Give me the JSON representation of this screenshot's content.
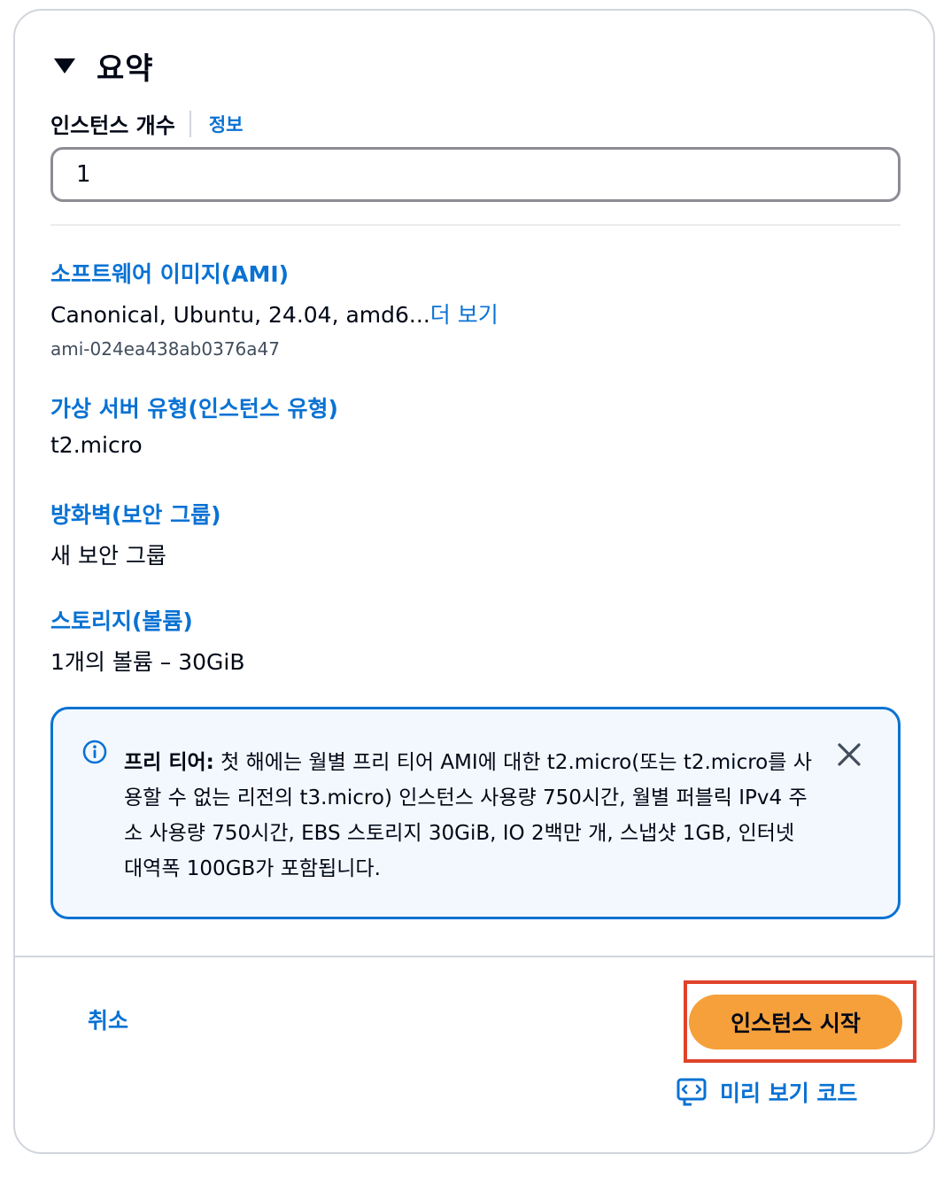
{
  "summary": {
    "title": "요약"
  },
  "instance_count": {
    "label": "인스턴스 개수",
    "info_link": "정보",
    "value": "1"
  },
  "ami": {
    "title": "소프트웨어 이미지(AMI)",
    "value": "Canonical, Ubuntu, 24.04, amd6...",
    "more_link": "더 보기",
    "id": "ami-024ea438ab0376a47"
  },
  "instance_type": {
    "title": "가상 서버 유형(인스턴스 유형)",
    "value": "t2.micro"
  },
  "firewall": {
    "title": "방화벽(보안 그룹)",
    "value": "새 보안 그룹"
  },
  "storage": {
    "title": "스토리지(볼륨)",
    "value": "1개의 볼륨 – 30GiB"
  },
  "free_tier_alert": {
    "title": "프리 티어:",
    "body": "첫 해에는 월별 프리 티어 AMI에 대한 t2.micro(또는 t2.micro를 사용할 수 없는 리전의 t3.micro) 인스턴스 사용량 750시간, 월별 퍼블릭 IPv4 주소 사용량 750시간, EBS 스토리지 30GiB, IO 2백만 개, 스냅샷 1GB, 인터넷 대역폭 100GB가 포함됩니다.",
    "icon": "info-icon",
    "close_icon": "close-icon"
  },
  "footer": {
    "cancel_label": "취소",
    "launch_label": "인스턴스 시작",
    "preview_label": "미리 보기 코드",
    "preview_icon": "code-preview-icon"
  },
  "colors": {
    "link": "#0972d3",
    "primary_button": "#f5a03a",
    "highlight": "#e0432b",
    "alert_bg": "#f2f8fd"
  }
}
